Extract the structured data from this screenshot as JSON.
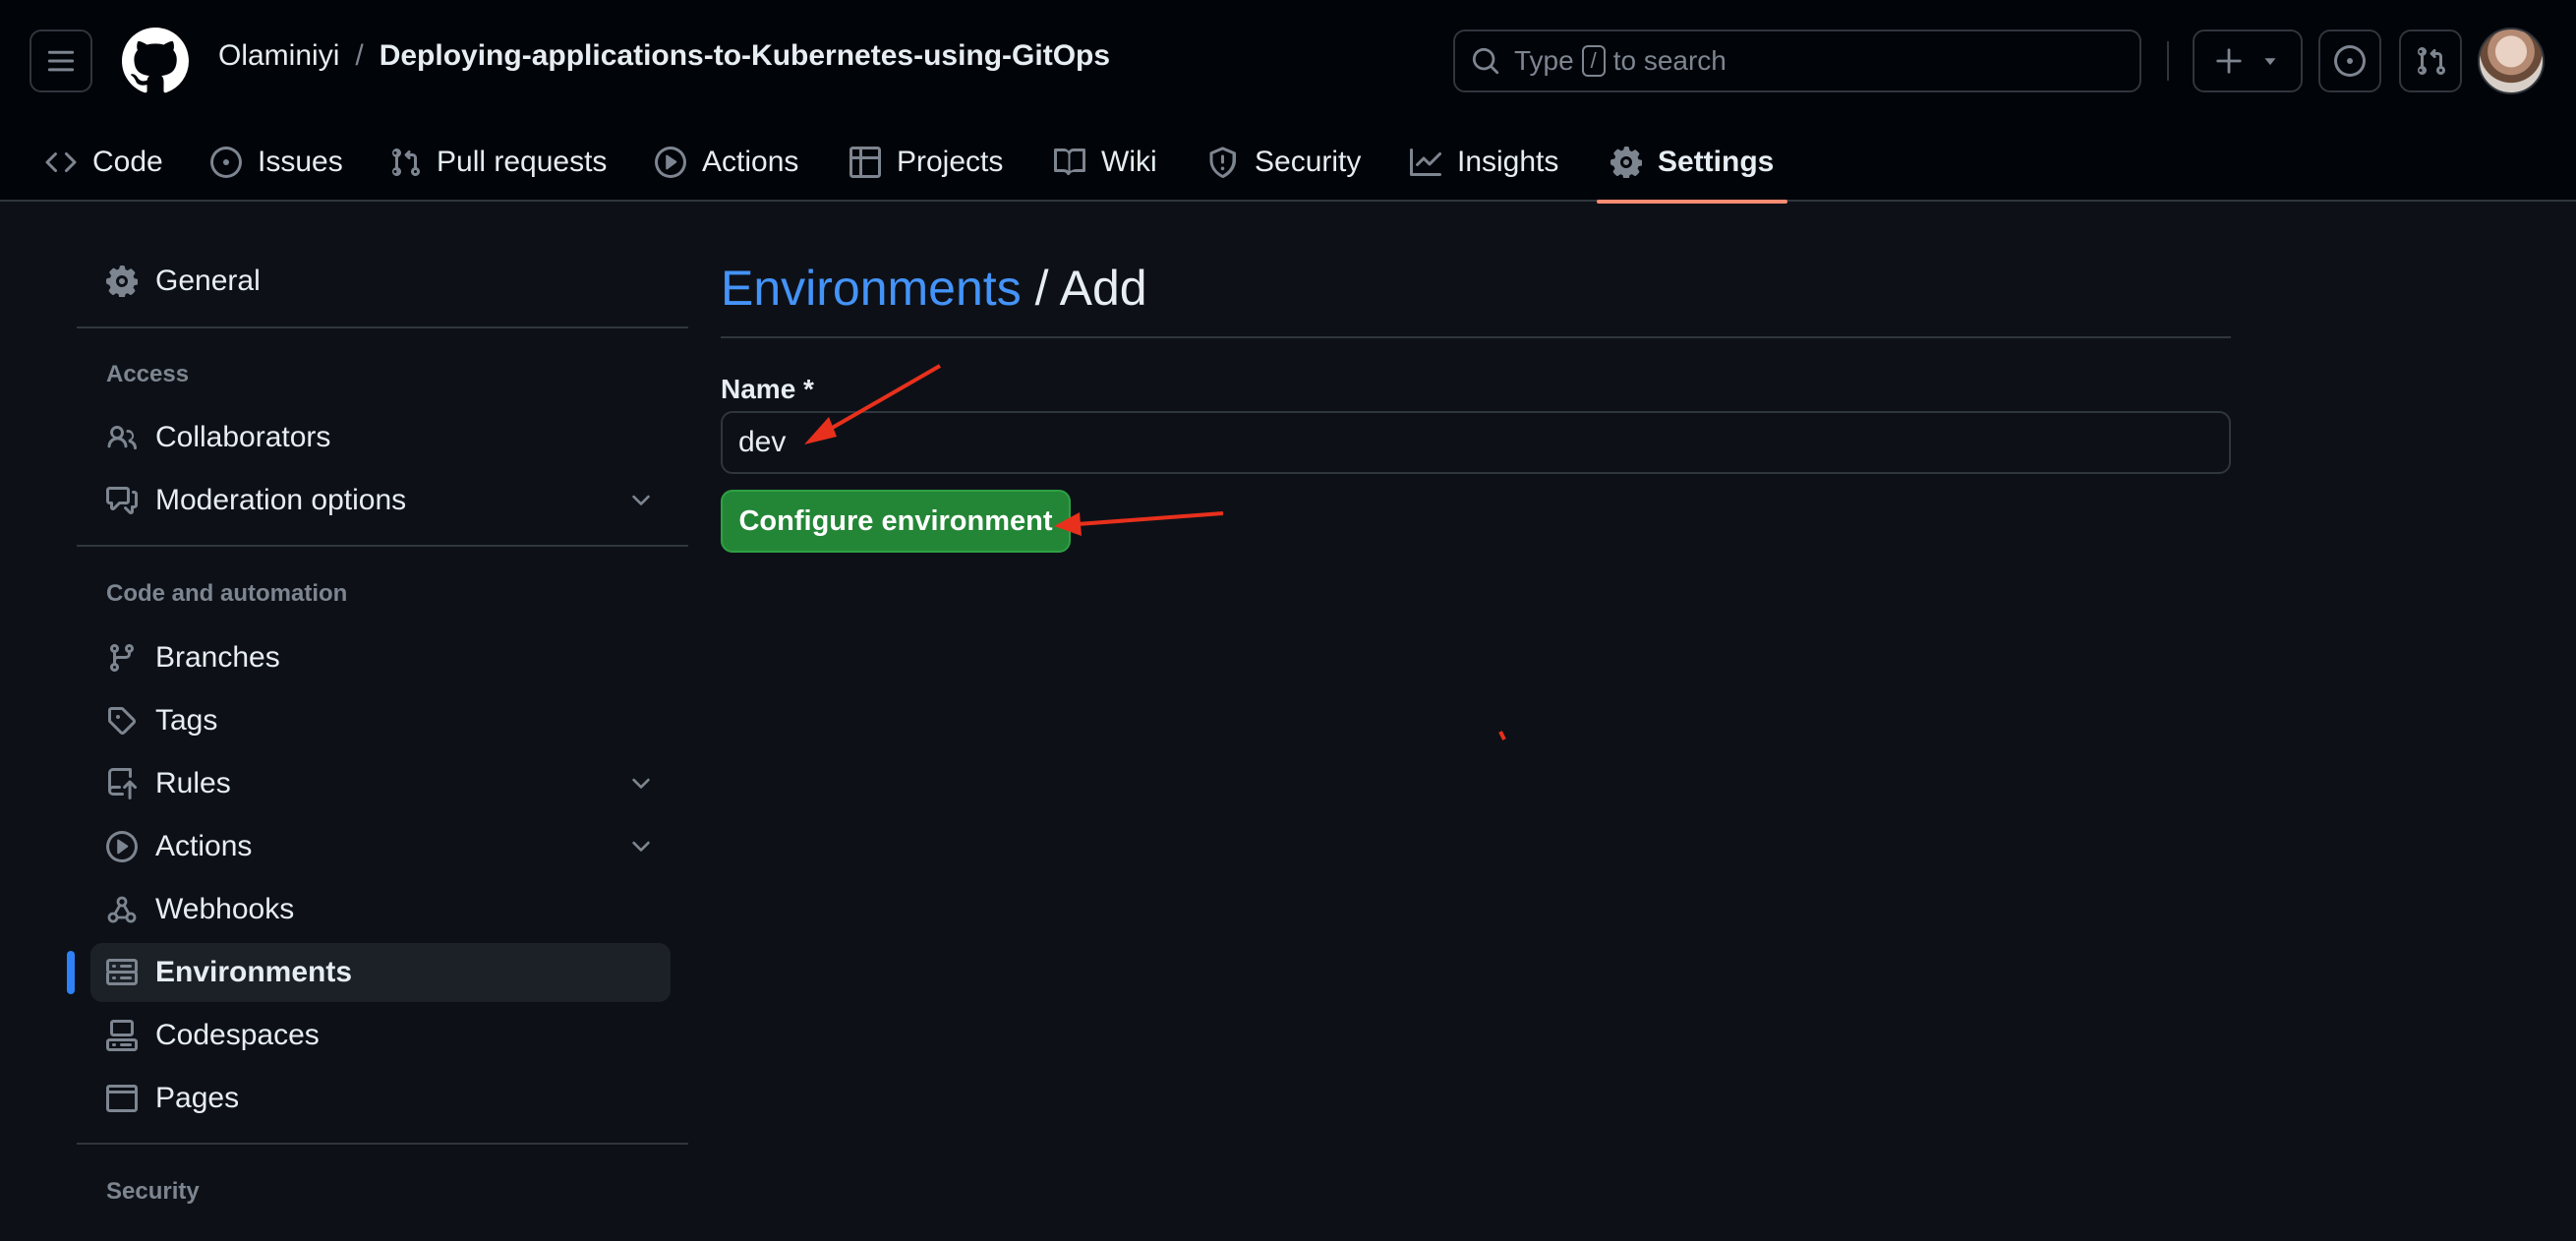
{
  "header": {
    "owner": "Olaminiyi",
    "separator": "/",
    "repo": "Deploying-applications-to-Kubernetes-using-GitOps",
    "search": {
      "prefix": "Type",
      "key": "/",
      "suffix": "to search"
    }
  },
  "tabs": [
    {
      "label": "Code",
      "icon": "code-icon"
    },
    {
      "label": "Issues",
      "icon": "issue-opened-icon"
    },
    {
      "label": "Pull requests",
      "icon": "git-pull-request-icon"
    },
    {
      "label": "Actions",
      "icon": "play-icon"
    },
    {
      "label": "Projects",
      "icon": "table-icon"
    },
    {
      "label": "Wiki",
      "icon": "book-icon"
    },
    {
      "label": "Security",
      "icon": "shield-icon"
    },
    {
      "label": "Insights",
      "icon": "graph-icon"
    },
    {
      "label": "Settings",
      "icon": "gear-icon",
      "active": true
    }
  ],
  "sidebar": {
    "general": "General",
    "access_heading": "Access",
    "collaborators": "Collaborators",
    "moderation": "Moderation options",
    "code_heading": "Code and automation",
    "branches": "Branches",
    "tags": "Tags",
    "rules": "Rules",
    "actions": "Actions",
    "webhooks": "Webhooks",
    "environments": "Environments",
    "codespaces": "Codespaces",
    "pages": "Pages",
    "security_heading": "Security"
  },
  "main": {
    "title_link": "Environments",
    "title_rest": "/ Add",
    "name_label": "Name *",
    "name_value": "dev",
    "configure_button": "Configure environment"
  },
  "colors": {
    "background": "#0d1117",
    "header_bg": "#010409",
    "accent_link": "#4493f8",
    "primary_button": "#238636",
    "tab_underline": "#fd8c73",
    "annotation_arrow": "#e8301c"
  }
}
